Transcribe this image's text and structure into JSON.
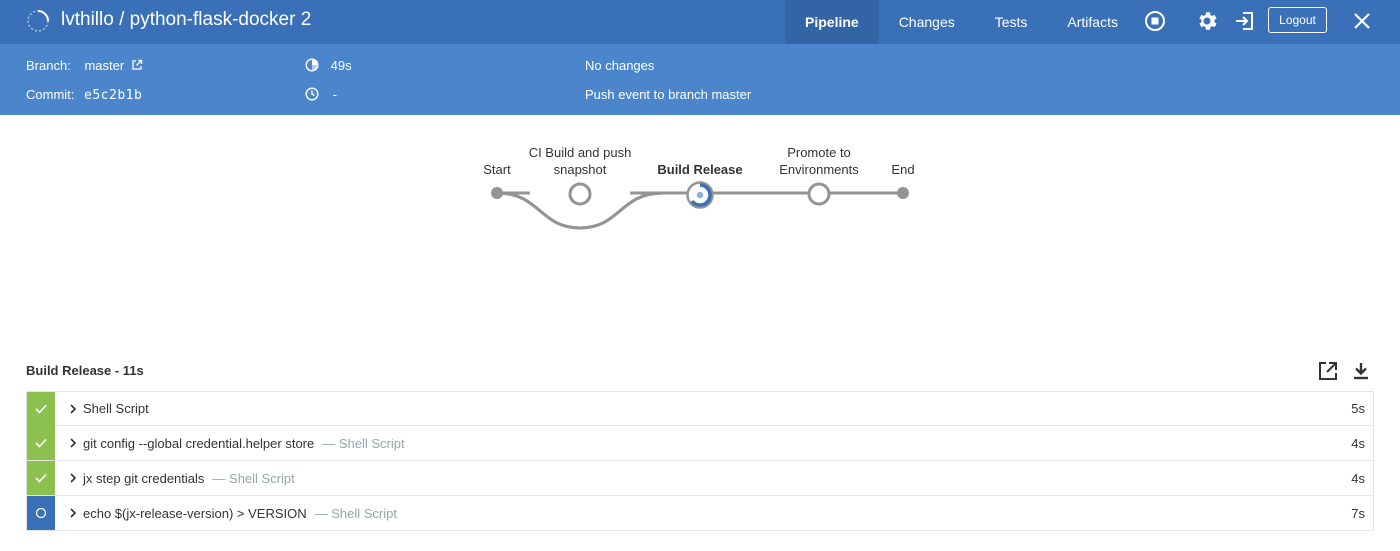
{
  "header": {
    "title": "lvthillo / python-flask-docker 2",
    "tabs": [
      {
        "label": "Pipeline",
        "active": true
      },
      {
        "label": "Changes",
        "active": false
      },
      {
        "label": "Tests",
        "active": false
      },
      {
        "label": "Artifacts",
        "active": false
      }
    ],
    "logout_label": "Logout",
    "icons": [
      "stop-icon",
      "gear-icon",
      "exit-icon",
      "close-icon"
    ],
    "colors": {
      "bar": "#3a70b7",
      "subbar": "#4b86cc",
      "success": "#8cc04f"
    }
  },
  "info": {
    "branch_label": "Branch:",
    "branch_value": "master",
    "commit_label": "Commit:",
    "commit_value": "e5c2b1b",
    "duration": "49s",
    "end_time": "-",
    "changes": "No changes",
    "cause": "Push event to branch master"
  },
  "pipeline": {
    "stages": [
      {
        "label": "Start"
      },
      {
        "label": "CI Build and push snapshot",
        "line1": "CI Build and push",
        "line2": "snapshot"
      },
      {
        "label": "Build Release"
      },
      {
        "label": "Promote to Environments",
        "line1": "Promote to",
        "line2": "Environments"
      },
      {
        "label": "End"
      }
    ]
  },
  "steps_panel": {
    "title": "Build Release - 11s",
    "steps": [
      {
        "name": "Shell Script",
        "type": "",
        "time": "5s",
        "status": "success"
      },
      {
        "name": "git config --global credential.helper store",
        "type": "— Shell Script",
        "time": "4s",
        "status": "success"
      },
      {
        "name": "jx step git credentials",
        "type": "— Shell Script",
        "time": "4s",
        "status": "success"
      },
      {
        "name": "echo $(jx-release-version) > VERSION",
        "type": "— Shell Script",
        "time": "7s",
        "status": "running"
      }
    ]
  }
}
